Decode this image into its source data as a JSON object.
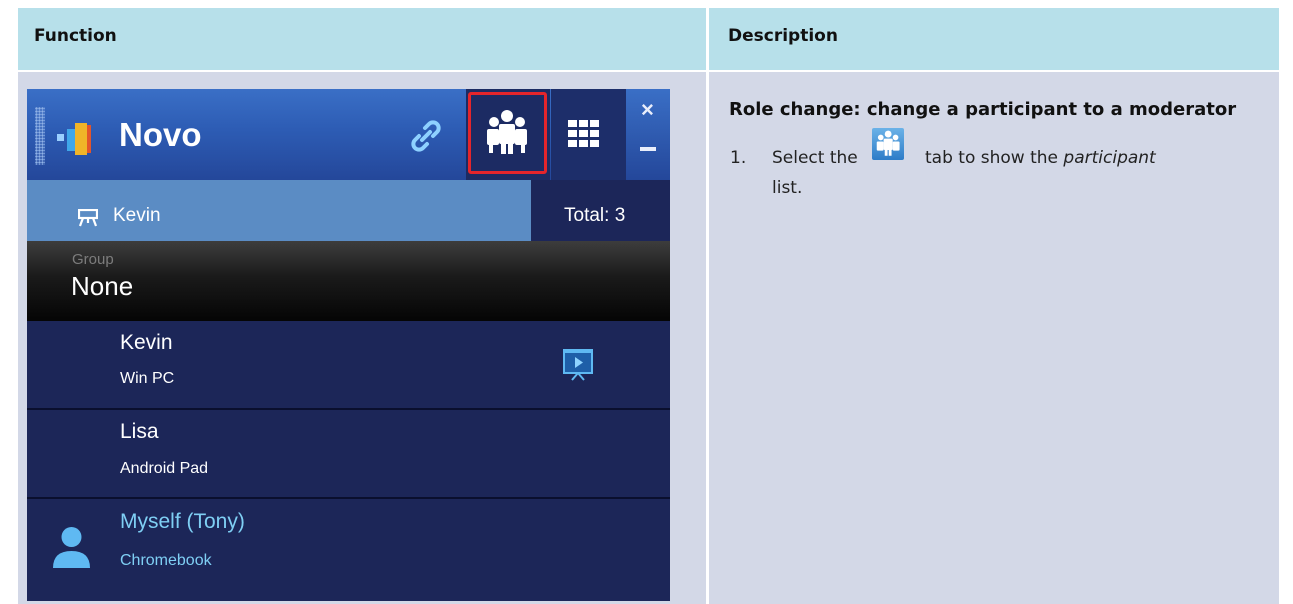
{
  "table": {
    "headers": [
      "Function",
      "Description"
    ]
  },
  "app": {
    "title": "Novo",
    "presenter": "Kevin",
    "total": "Total: 3",
    "group_label": "Group",
    "group_value": "None",
    "participants": [
      {
        "name": "Kevin",
        "device": "Win PC",
        "presenting": true
      },
      {
        "name": "Lisa",
        "device": "Android Pad"
      },
      {
        "name": "Myself (Tony)",
        "device": "Chromebook",
        "is_self": true
      }
    ],
    "colors": {
      "titlebar": "#2d5cb4",
      "highlight": "#e4252b",
      "self_text": "#7fcff4"
    },
    "icons": [
      "link-icon",
      "participants-icon",
      "grid-icon",
      "close-icon",
      "minimize-icon",
      "presenter-icon",
      "present-screen-icon",
      "avatar-icon"
    ]
  },
  "description": {
    "heading": "Role change: change a participant to a moderator",
    "step1": {
      "number": "1.",
      "pre": "Select the",
      "post": "tab to show the",
      "emphasis": "participant",
      "end": "list."
    }
  }
}
